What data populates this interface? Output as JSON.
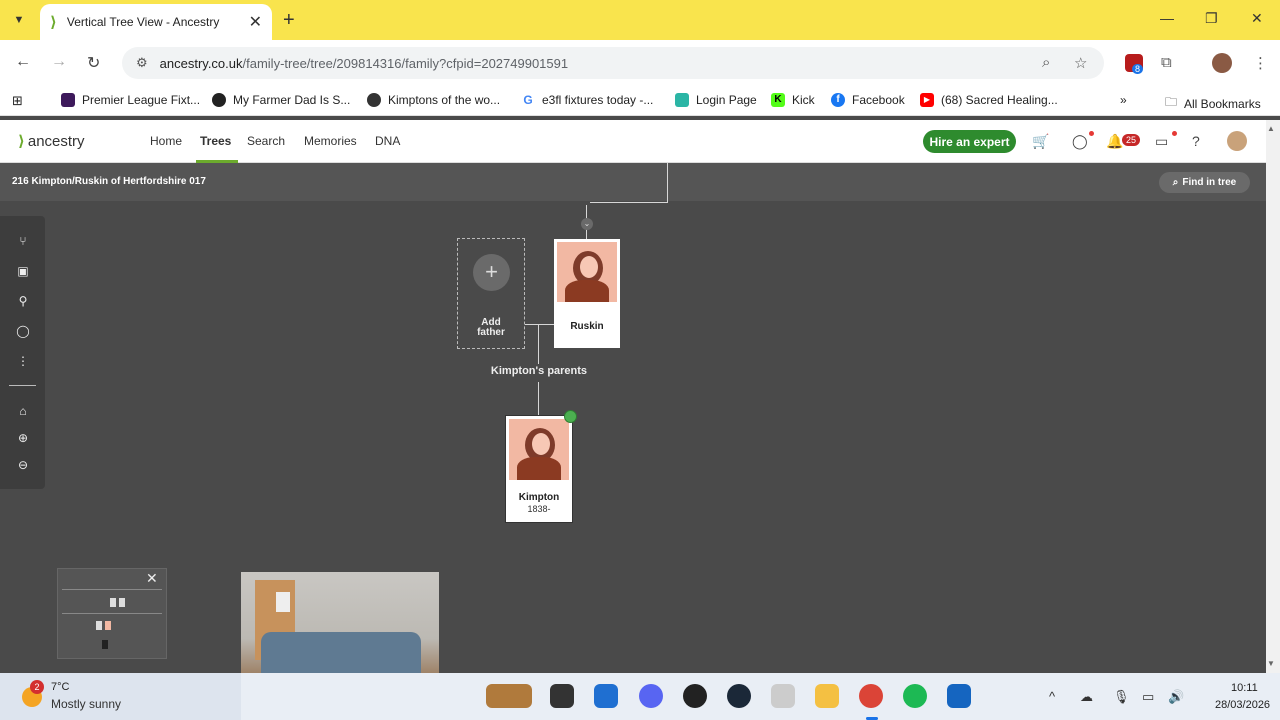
{
  "browser": {
    "tab_title": "Vertical Tree View - Ancestry",
    "url_host": "ancestry.co.uk",
    "url_path": "/family-tree/tree/209814316/family?cfpid=202749901591",
    "extension_badge": "8",
    "bookmarks": [
      {
        "label": "Premier League Fixt...",
        "icon": "premier-league-icon",
        "color": "#3d195b"
      },
      {
        "label": "My Farmer Dad Is S...",
        "icon": "threads-icon",
        "color": "#222222"
      },
      {
        "label": "Kimptons of the wo...",
        "icon": "globe-icon",
        "color": "#333333"
      },
      {
        "label": "e3fl fixtures today -...",
        "icon": "google-icon",
        "color": "#4285f4"
      },
      {
        "label": "Login Page",
        "icon": "login-icon",
        "color": "#2bb5a5"
      },
      {
        "label": "Kick",
        "icon": "kick-icon",
        "color": "#53fc18"
      },
      {
        "label": "Facebook",
        "icon": "facebook-icon",
        "color": "#1877f2"
      },
      {
        "label": "(68) Sacred Healing...",
        "icon": "youtube-icon",
        "color": "#ff0000"
      }
    ],
    "all_bookmarks": "All Bookmarks"
  },
  "ancestry": {
    "logo": "ancestry",
    "nav": [
      "Home",
      "Trees",
      "Search",
      "Memories",
      "DNA"
    ],
    "hire_expert": "Hire an expert",
    "notifications_count": "25",
    "tree_name": "216 Kimpton/Ruskin of Hertfordshire 017",
    "find_in_tree": "Find in tree",
    "add_father": "Add father",
    "mother_name": "Ruskin",
    "parents_label": "Kimpton's parents",
    "focus_name": "Kimpton",
    "focus_years": "1838-",
    "accent": "#6cab2d"
  },
  "taskbar": {
    "weather_alerts": "2",
    "temperature": "7°C",
    "weather_desc": "Mostly sunny",
    "time": "10:11",
    "date": "28/03/2026"
  }
}
